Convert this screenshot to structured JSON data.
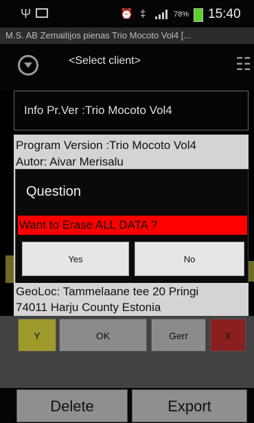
{
  "status_bar": {
    "icons": [
      "usb-icon",
      "image-icon",
      "alarm-icon",
      "vibrate-icon",
      "signal-icon",
      "battery-icon"
    ],
    "battery": "78%",
    "time": "15:40"
  },
  "app_title": "M.S. AB Zemaitijos pienas Trio Mocoto Vol4 [...",
  "select_client": "<Select client>",
  "info_bar": "Info  Pr.Ver :Trio Mocoto Vol4",
  "info": {
    "program_version": "Program Version :Trio Mocoto Vol4",
    "author": "Autor: Aivar Merisalu"
  },
  "dialog": {
    "title": "Question",
    "message": "Want to Erase ALL DATA ?",
    "yes_label": "Yes",
    "no_label": "No"
  },
  "geoloc": {
    "line1": "GeoLoc: Tammelaane tee 20 Pringi",
    "line2": "74011 Harju County Estonia"
  },
  "action_buttons": {
    "y": "Y",
    "ok": "OK",
    "gerr": "Gerr",
    "x": "X"
  },
  "bottom": {
    "delete": "Delete",
    "export": "Export"
  },
  "colors": {
    "alert_red": "#ff0000",
    "dialog_bg": "#0a0a0a",
    "battery_green": "#5ad02a"
  }
}
